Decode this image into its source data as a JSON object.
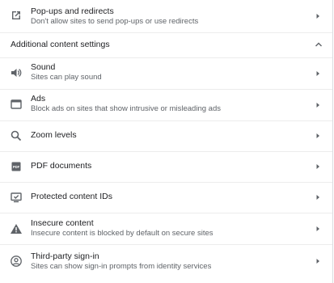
{
  "popups": {
    "title": "Pop-ups and redirects",
    "subtitle": "Don't allow sites to send pop-ups or use redirects",
    "icon": "open-in-new-icon"
  },
  "additional": {
    "label": "Additional content settings",
    "icon": "chevron-up-icon"
  },
  "items": [
    {
      "title": "Sound",
      "subtitle": "Sites can play sound",
      "icon": "speaker-icon"
    },
    {
      "title": "Ads",
      "subtitle": "Block ads on sites that show intrusive or misleading ads",
      "icon": "window-icon"
    },
    {
      "title": "Zoom levels",
      "subtitle": "",
      "icon": "search-icon"
    },
    {
      "title": "PDF documents",
      "subtitle": "",
      "icon": "pdf-icon"
    },
    {
      "title": "Protected content IDs",
      "subtitle": "",
      "icon": "protected-content-icon"
    },
    {
      "title": "Insecure content",
      "subtitle": "Insecure content is blocked by default on secure sites",
      "icon": "warning-icon"
    },
    {
      "title": "Third-party sign-in",
      "subtitle": "Sites can show sign-in prompts from identity services",
      "icon": "account-circle-icon"
    }
  ],
  "colors": {
    "icon": "#5f6368",
    "text": "#202124",
    "secondary": "#5f6368",
    "divider": "#ececec"
  }
}
